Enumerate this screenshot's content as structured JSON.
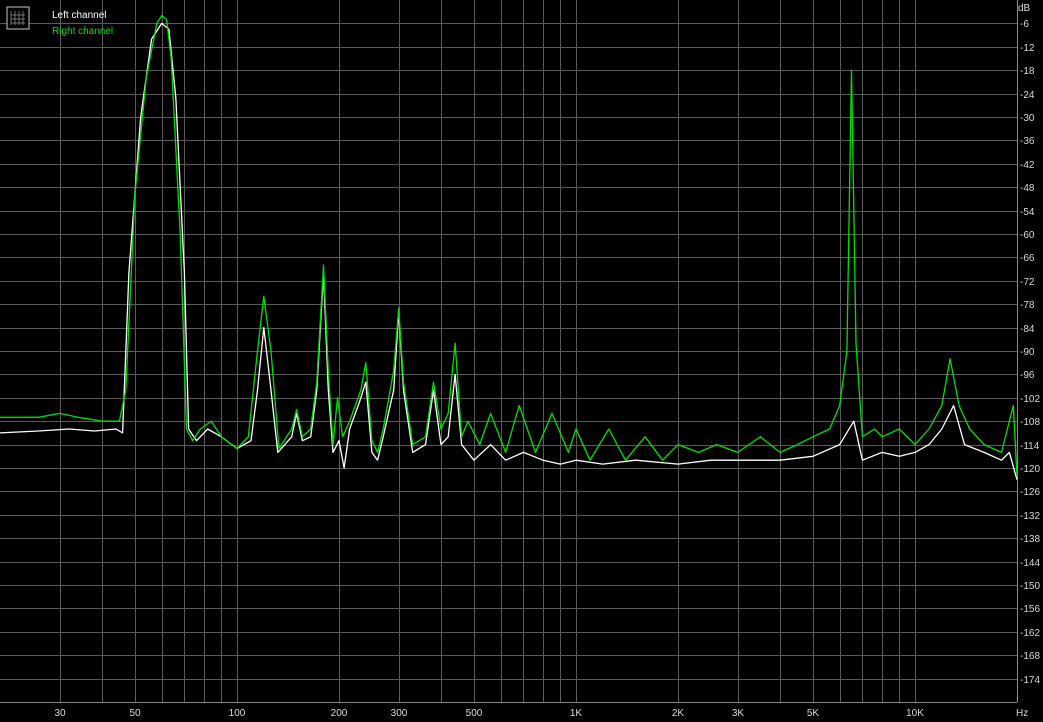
{
  "chart_data": {
    "type": "line",
    "title": "",
    "x_unit": "Hz",
    "y_unit": "dB",
    "x_scale": "log",
    "xlim": [
      20,
      20000
    ],
    "ylim": [
      -180,
      0
    ],
    "grid": true,
    "legend_position": "top-left",
    "x_ticks": [
      {
        "value": 30,
        "label": "30"
      },
      {
        "value": 50,
        "label": "50"
      },
      {
        "value": 100,
        "label": "100"
      },
      {
        "value": 200,
        "label": "200"
      },
      {
        "value": 300,
        "label": "300"
      },
      {
        "value": 500,
        "label": "500"
      },
      {
        "value": 1000,
        "label": "1K"
      },
      {
        "value": 2000,
        "label": "2K"
      },
      {
        "value": 3000,
        "label": "3K"
      },
      {
        "value": 5000,
        "label": "5K"
      },
      {
        "value": 10000,
        "label": "10K"
      }
    ],
    "x_grid_values": [
      30,
      40,
      50,
      60,
      70,
      80,
      90,
      100,
      200,
      300,
      400,
      500,
      600,
      700,
      800,
      900,
      1000,
      2000,
      3000,
      4000,
      5000,
      6000,
      7000,
      8000,
      9000,
      10000,
      20000
    ],
    "y_ticks": [
      -6,
      -12,
      -18,
      -24,
      -30,
      -36,
      -42,
      -48,
      -54,
      -60,
      -66,
      -72,
      -78,
      -84,
      -90,
      -96,
      -102,
      -108,
      -114,
      -120,
      -126,
      -132,
      -138,
      -144,
      -150,
      -156,
      -162,
      -168,
      -174
    ],
    "series": [
      {
        "name": "Left channel",
        "color": "#ffffff",
        "points": [
          [
            20,
            -111
          ],
          [
            26,
            -110.5
          ],
          [
            32,
            -110
          ],
          [
            38,
            -110.5
          ],
          [
            44,
            -110
          ],
          [
            46,
            -111
          ],
          [
            48,
            -70
          ],
          [
            52,
            -30
          ],
          [
            56,
            -10
          ],
          [
            60,
            -6
          ],
          [
            63,
            -7.5
          ],
          [
            66,
            -25
          ],
          [
            70,
            -70
          ],
          [
            72,
            -110
          ],
          [
            76,
            -113
          ],
          [
            82,
            -110
          ],
          [
            90,
            -112
          ],
          [
            100,
            -115
          ],
          [
            110,
            -113
          ],
          [
            115,
            -100
          ],
          [
            120,
            -84
          ],
          [
            126,
            -100
          ],
          [
            132,
            -116
          ],
          [
            145,
            -112
          ],
          [
            150,
            -106
          ],
          [
            156,
            -113
          ],
          [
            165,
            -112
          ],
          [
            172,
            -100
          ],
          [
            180,
            -70
          ],
          [
            186,
            -100
          ],
          [
            192,
            -116
          ],
          [
            200,
            -113
          ],
          [
            207,
            -120
          ],
          [
            215,
            -110
          ],
          [
            230,
            -103
          ],
          [
            240,
            -98
          ],
          [
            250,
            -116
          ],
          [
            260,
            -118
          ],
          [
            270,
            -112
          ],
          [
            290,
            -100
          ],
          [
            300,
            -80
          ],
          [
            310,
            -100
          ],
          [
            330,
            -116
          ],
          [
            360,
            -114
          ],
          [
            380,
            -100
          ],
          [
            400,
            -114
          ],
          [
            420,
            -112
          ],
          [
            440,
            -96
          ],
          [
            460,
            -114
          ],
          [
            500,
            -118
          ],
          [
            560,
            -114
          ],
          [
            620,
            -118
          ],
          [
            700,
            -116
          ],
          [
            800,
            -118
          ],
          [
            900,
            -119
          ],
          [
            1000,
            -118
          ],
          [
            1200,
            -119
          ],
          [
            1500,
            -118
          ],
          [
            2000,
            -119
          ],
          [
            2500,
            -118
          ],
          [
            3000,
            -118
          ],
          [
            4000,
            -118
          ],
          [
            5000,
            -117
          ],
          [
            6000,
            -114
          ],
          [
            6600,
            -108
          ],
          [
            7000,
            -118
          ],
          [
            8000,
            -116
          ],
          [
            9000,
            -117
          ],
          [
            10000,
            -116
          ],
          [
            11000,
            -114
          ],
          [
            12000,
            -110
          ],
          [
            13000,
            -104
          ],
          [
            14000,
            -114
          ],
          [
            16000,
            -116
          ],
          [
            18000,
            -118
          ],
          [
            19000,
            -116
          ],
          [
            20000,
            -123
          ]
        ]
      },
      {
        "name": "Right channel",
        "color": "#00e000",
        "points": [
          [
            20,
            -107
          ],
          [
            26,
            -107
          ],
          [
            30,
            -106
          ],
          [
            34,
            -107
          ],
          [
            40,
            -108
          ],
          [
            45,
            -108
          ],
          [
            47,
            -100
          ],
          [
            50,
            -50
          ],
          [
            54,
            -20
          ],
          [
            58,
            -6
          ],
          [
            60,
            -4
          ],
          [
            62,
            -5
          ],
          [
            64,
            -15
          ],
          [
            68,
            -60
          ],
          [
            71,
            -110
          ],
          [
            74,
            -113
          ],
          [
            78,
            -110
          ],
          [
            84,
            -108
          ],
          [
            90,
            -112
          ],
          [
            100,
            -115
          ],
          [
            108,
            -112
          ],
          [
            115,
            -90
          ],
          [
            120,
            -76
          ],
          [
            126,
            -90
          ],
          [
            133,
            -115
          ],
          [
            145,
            -110
          ],
          [
            150,
            -105
          ],
          [
            156,
            -112
          ],
          [
            165,
            -110
          ],
          [
            172,
            -98
          ],
          [
            180,
            -68
          ],
          [
            186,
            -95
          ],
          [
            192,
            -114
          ],
          [
            198,
            -102
          ],
          [
            205,
            -112
          ],
          [
            215,
            -108
          ],
          [
            232,
            -100
          ],
          [
            240,
            -93
          ],
          [
            250,
            -113
          ],
          [
            260,
            -116
          ],
          [
            270,
            -110
          ],
          [
            290,
            -95
          ],
          [
            300,
            -79
          ],
          [
            310,
            -98
          ],
          [
            330,
            -114
          ],
          [
            360,
            -112
          ],
          [
            380,
            -98
          ],
          [
            400,
            -110
          ],
          [
            420,
            -106
          ],
          [
            440,
            -88
          ],
          [
            460,
            -112
          ],
          [
            480,
            -108
          ],
          [
            520,
            -114
          ],
          [
            560,
            -106
          ],
          [
            620,
            -116
          ],
          [
            680,
            -104
          ],
          [
            760,
            -116
          ],
          [
            850,
            -106
          ],
          [
            950,
            -116
          ],
          [
            1000,
            -110
          ],
          [
            1100,
            -118
          ],
          [
            1250,
            -110
          ],
          [
            1400,
            -118
          ],
          [
            1600,
            -112
          ],
          [
            1800,
            -118
          ],
          [
            2000,
            -114
          ],
          [
            2300,
            -116
          ],
          [
            2600,
            -114
          ],
          [
            3000,
            -116
          ],
          [
            3500,
            -112
          ],
          [
            4000,
            -116
          ],
          [
            4500,
            -114
          ],
          [
            5000,
            -112
          ],
          [
            5600,
            -110
          ],
          [
            6000,
            -104
          ],
          [
            6300,
            -90
          ],
          [
            6500,
            -18
          ],
          [
            6700,
            -88
          ],
          [
            7000,
            -112
          ],
          [
            7600,
            -110
          ],
          [
            8000,
            -112
          ],
          [
            9000,
            -110
          ],
          [
            10000,
            -114
          ],
          [
            11000,
            -110
          ],
          [
            12000,
            -104
          ],
          [
            12700,
            -92
          ],
          [
            13500,
            -104
          ],
          [
            14500,
            -110
          ],
          [
            16000,
            -114
          ],
          [
            18000,
            -116
          ],
          [
            19500,
            -104
          ],
          [
            20000,
            -122
          ]
        ]
      }
    ]
  }
}
